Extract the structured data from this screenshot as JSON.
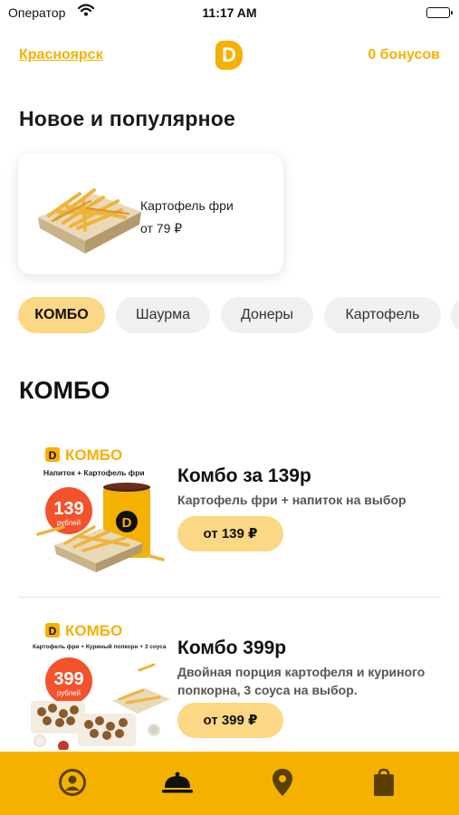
{
  "status_bar": {
    "carrier": "Оператор",
    "time": "11:17 AM"
  },
  "header": {
    "city": "Красноярск",
    "logo_letter": "D",
    "bonuses": "0 бонусов"
  },
  "new_popular": {
    "title": "Новое и популярное",
    "items": [
      {
        "name": "Картофель фри",
        "price": "от 79 ₽"
      }
    ]
  },
  "category_tabs": [
    {
      "label": "КОМБО",
      "active": true
    },
    {
      "label": "Шаурма",
      "active": false
    },
    {
      "label": "Донеры",
      "active": false
    },
    {
      "label": "Картофель",
      "active": false
    }
  ],
  "section": {
    "title": "КОМБО"
  },
  "products": [
    {
      "title": "Комбо за 139р",
      "description": "Картофель фри + напиток на выбор",
      "price_button": "от 139 ₽",
      "image": {
        "brand": "КОМБО",
        "subtitle": "Напиток + Картофель фри",
        "badge_number": "139",
        "badge_unit": "рублей"
      }
    },
    {
      "title": "Комбо 399р",
      "description": "Двойная порция картофеля и куриного попкорна, 3 соуса на выбор.",
      "price_button": "от 399 ₽",
      "image": {
        "brand": "КОМБО",
        "subtitle": "Картофель фри + Куриный попкорн + 3 соуса",
        "badge_number": "399",
        "badge_unit": "рублей"
      }
    }
  ],
  "tabbar": {
    "icons": [
      "profile-icon",
      "menu-cloche-icon",
      "location-pin-icon",
      "shopping-bag-icon"
    ]
  },
  "colors": {
    "accent": "#f5b100",
    "chip_active": "#fcd784",
    "chip_inactive": "#f0f0f3",
    "badge_red": "#f2522c"
  }
}
